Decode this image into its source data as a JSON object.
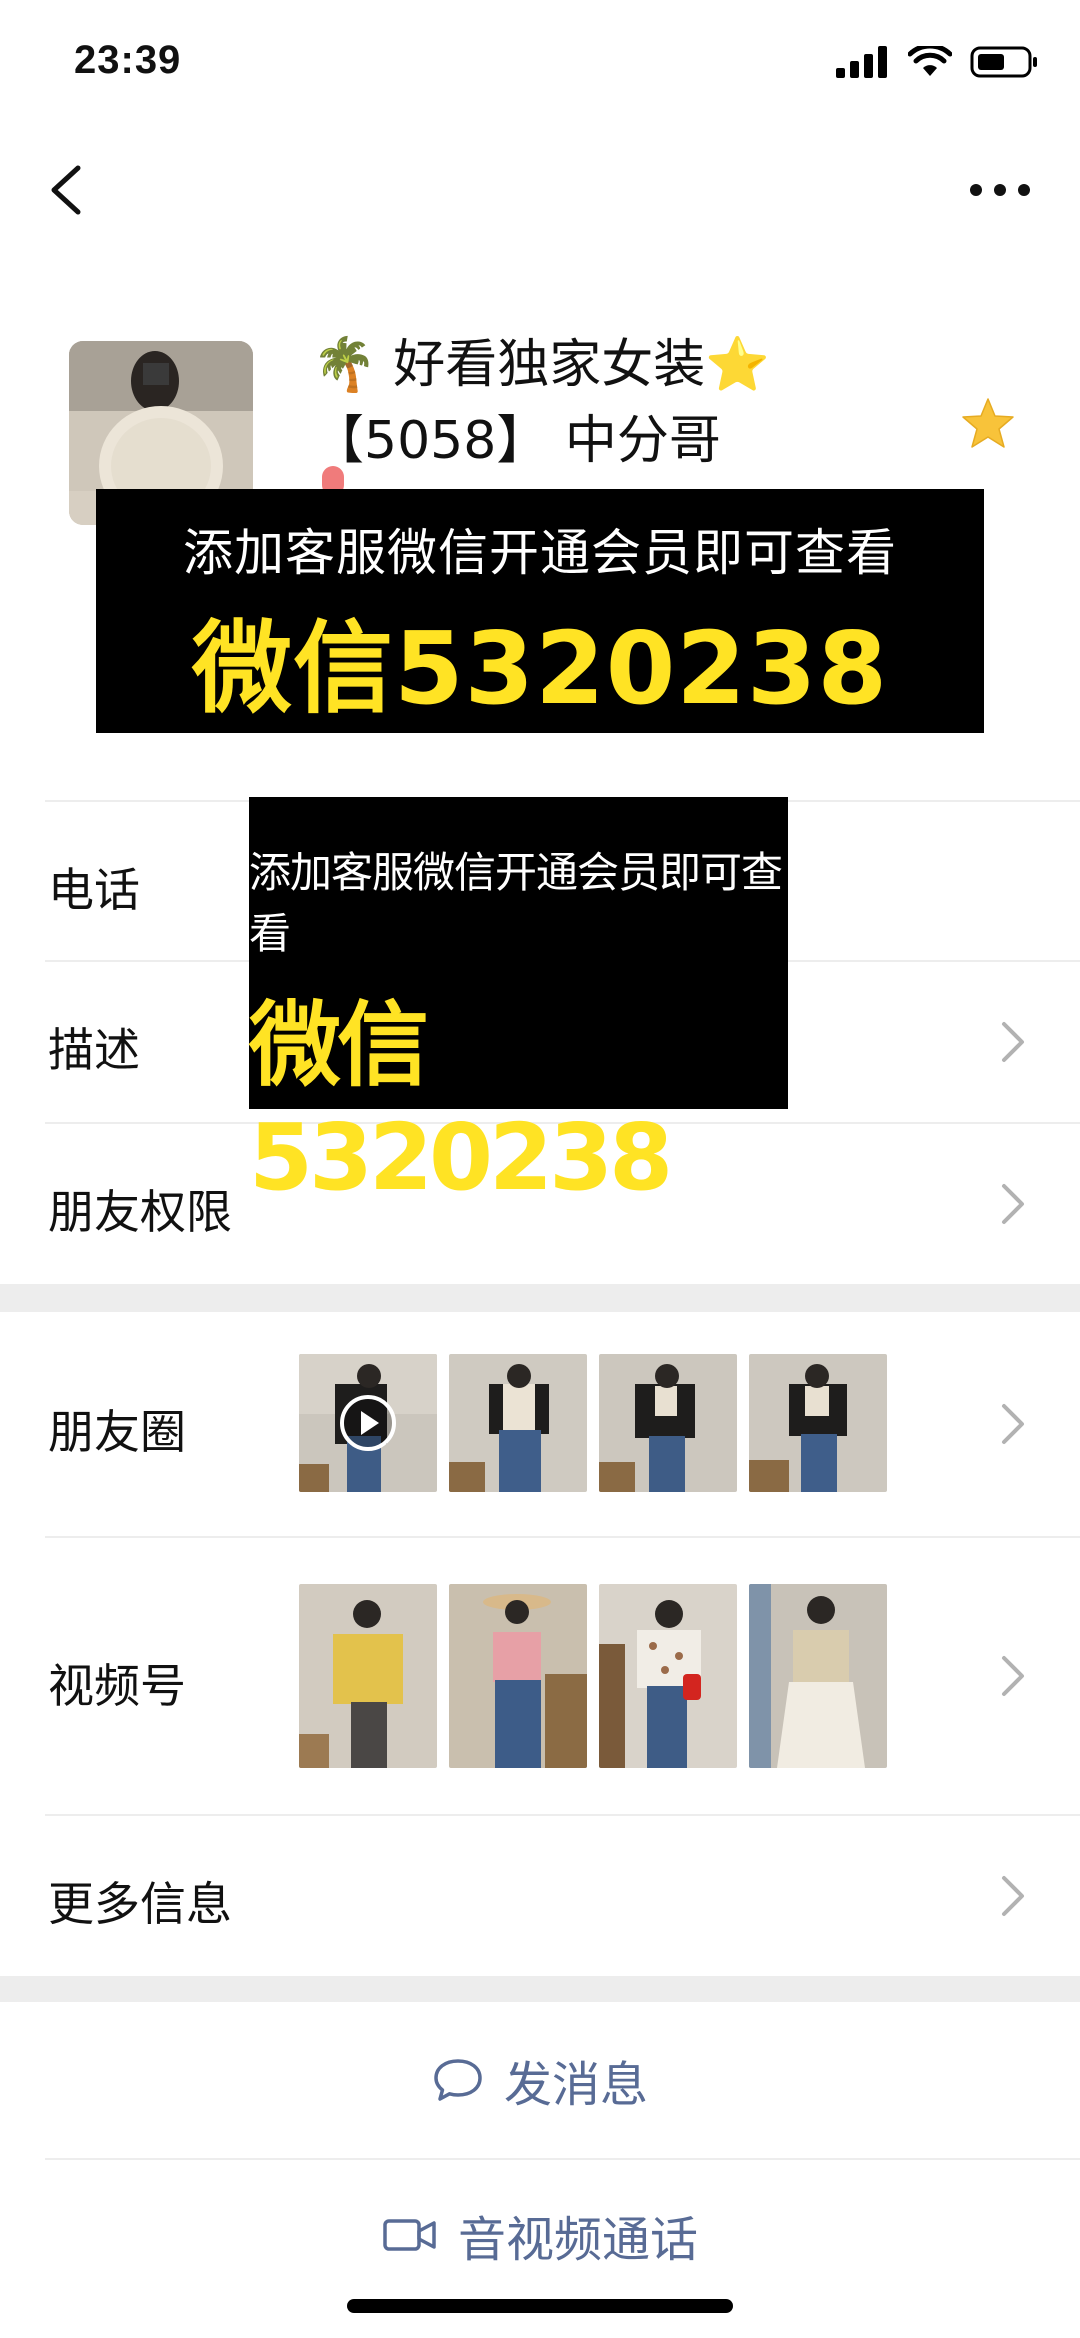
{
  "status": {
    "time": "23:39"
  },
  "profile": {
    "name_line1": "🌴 好看独家女装⭐",
    "name_line2": "【5058】 中分哥"
  },
  "overlay": {
    "top_text": "添加客服微信开通会员即可查看",
    "wechat_id": "微信5320238"
  },
  "rows": {
    "phone": "电话",
    "description": "描述",
    "friend_permissions": "朋友权限",
    "moments": "朋友圈",
    "channels": "视频号",
    "more_info": "更多信息"
  },
  "actions": {
    "send_message": "发消息",
    "video_call": "音视频通话"
  },
  "colors": {
    "link": "#586b95",
    "banner_yellow": "#ffe324",
    "section_gap": "#ededed",
    "star": "#f8c33a"
  }
}
